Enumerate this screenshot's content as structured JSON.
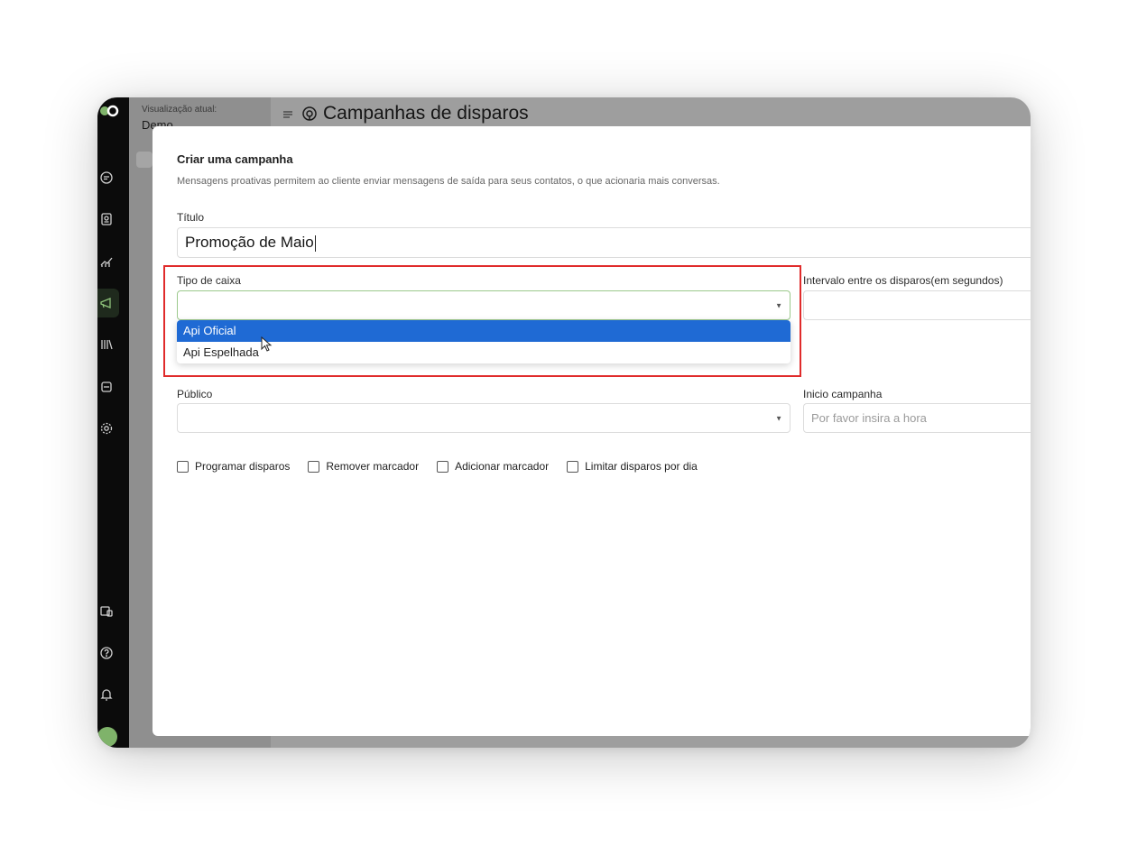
{
  "sidebar": {
    "view_label": "Visualização atual:",
    "view_value": "Demo",
    "icons": [
      "logo",
      "chat-icon",
      "contacts-icon",
      "reports-icon",
      "campaign-icon",
      "library-icon",
      "bot-icon",
      "settings-icon",
      "dashboard-icon",
      "help-icon",
      "bell-icon",
      "avatar"
    ]
  },
  "header": {
    "title": "Campanhas de disparos"
  },
  "modal": {
    "title": "Criar uma campanha",
    "description": "Mensagens proativas permitem ao cliente enviar mensagens de saída para seus contatos, o que acionaria mais conversas.",
    "title_label": "Título",
    "title_value": "Promoção de Maio",
    "inbox_type_label": "Tipo de caixa",
    "inbox_type_options": [
      "Api Oficial",
      "Api Espelhada"
    ],
    "interval_label": "Intervalo entre os disparos(em segundos)",
    "audience_label": "Público",
    "start_label": "Inicio campanha",
    "start_placeholder": "Por favor insira a hora",
    "checkboxes": [
      "Programar disparos",
      "Remover marcador",
      "Adicionar marcador",
      "Limitar disparos por dia"
    ]
  },
  "colors": {
    "accent": "#1f6ad4",
    "highlight": "#e02b2b",
    "rail": "#0b0b0b"
  }
}
